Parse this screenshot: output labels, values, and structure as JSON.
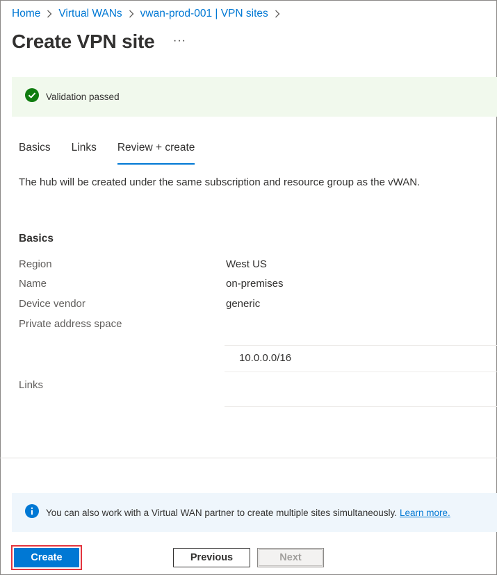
{
  "breadcrumb": {
    "items": [
      "Home",
      "Virtual WANs",
      "vwan-prod-001 | VPN sites"
    ]
  },
  "page": {
    "title": "Create VPN site",
    "more_label": "···"
  },
  "validation": {
    "text": "Validation passed",
    "status_color": "#107c10"
  },
  "tabs": [
    {
      "label": "Basics",
      "active": false
    },
    {
      "label": "Links",
      "active": false
    },
    {
      "label": "Review + create",
      "active": true
    }
  ],
  "description": "The hub will be created under the same subscription and resource group as the vWAN.",
  "basics": {
    "heading": "Basics",
    "fields": [
      {
        "label": "Region",
        "value": "West US"
      },
      {
        "label": "Name",
        "value": "on-premises"
      },
      {
        "label": "Device vendor",
        "value": "generic"
      },
      {
        "label": "Private address space",
        "value": ""
      }
    ],
    "address_spaces": [
      "10.0.0.0/16"
    ],
    "links_label": "Links"
  },
  "info": {
    "text": "You can also work with a Virtual WAN partner to create multiple sites simultaneously.",
    "link_text": "Learn more."
  },
  "footer": {
    "create_label": "Create",
    "previous_label": "Previous",
    "next_label": "Next"
  },
  "colors": {
    "accent": "#0078d4",
    "highlight_border": "#e3343d"
  }
}
